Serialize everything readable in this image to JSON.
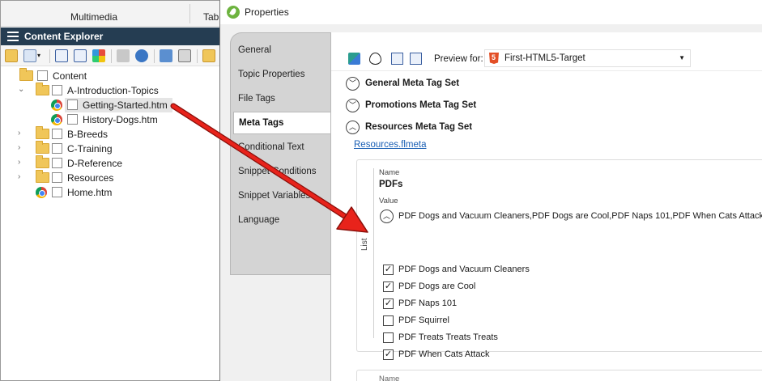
{
  "ribbon": {
    "tab_multimedia": "Multimedia",
    "tab_table": "Tabl"
  },
  "explorer": {
    "title": "Content Explorer",
    "tree": [
      {
        "label": "Content",
        "type": "folder",
        "expanded": true
      },
      {
        "label": "A-Introduction-Topics",
        "type": "folder",
        "expanded": true
      },
      {
        "label": "Getting-Started.htm",
        "type": "file",
        "selected": true
      },
      {
        "label": "History-Dogs.htm",
        "type": "file"
      },
      {
        "label": "B-Breeds",
        "type": "folder",
        "expanded": false
      },
      {
        "label": "C-Training",
        "type": "folder",
        "expanded": false
      },
      {
        "label": "D-Reference",
        "type": "folder",
        "expanded": false
      },
      {
        "label": "Resources",
        "type": "folder",
        "expanded": false
      },
      {
        "label": "Home.htm",
        "type": "file"
      }
    ]
  },
  "dialog": {
    "title": "Properties",
    "tabs": [
      {
        "label": "General"
      },
      {
        "label": "Topic Properties"
      },
      {
        "label": "File Tags"
      },
      {
        "label": "Meta Tags",
        "active": true
      },
      {
        "label": "Conditional Text"
      },
      {
        "label": "Snippet Conditions"
      },
      {
        "label": "Snippet Variables"
      },
      {
        "label": "Language"
      }
    ],
    "toolbar": {
      "preview_label": "Preview for:",
      "preview_value": "First-HTML5-Target"
    },
    "sections": [
      {
        "label": "General Meta Tag Set",
        "expanded": false
      },
      {
        "label": "Promotions Meta Tag Set",
        "expanded": false
      },
      {
        "label": "Resources Meta Tag Set",
        "expanded": true
      }
    ],
    "meta_file_link": "Resources.flmeta",
    "card": {
      "name_caption": "Name",
      "name_value": "PDFs",
      "value_caption": "Value",
      "value_summary": "PDF Dogs and Vacuum Cleaners,PDF Dogs are Cool,PDF Naps 101,PDF When Cats Attack",
      "list_caption": "List",
      "options": [
        {
          "label": "PDF Dogs and Vacuum Cleaners",
          "checked": true
        },
        {
          "label": "PDF Dogs are Cool",
          "checked": true
        },
        {
          "label": "PDF Naps 101",
          "checked": true
        },
        {
          "label": "PDF Squirrel",
          "checked": false
        },
        {
          "label": "PDF Treats Treats Treats",
          "checked": false
        },
        {
          "label": "PDF When Cats Attack",
          "checked": true
        }
      ]
    },
    "next_card": {
      "name_caption": "Name"
    }
  },
  "colors": {
    "explorer_header": "#253d52",
    "arrow": "#e8231b",
    "link": "#1a5fb4",
    "folder": "#f0c659"
  }
}
